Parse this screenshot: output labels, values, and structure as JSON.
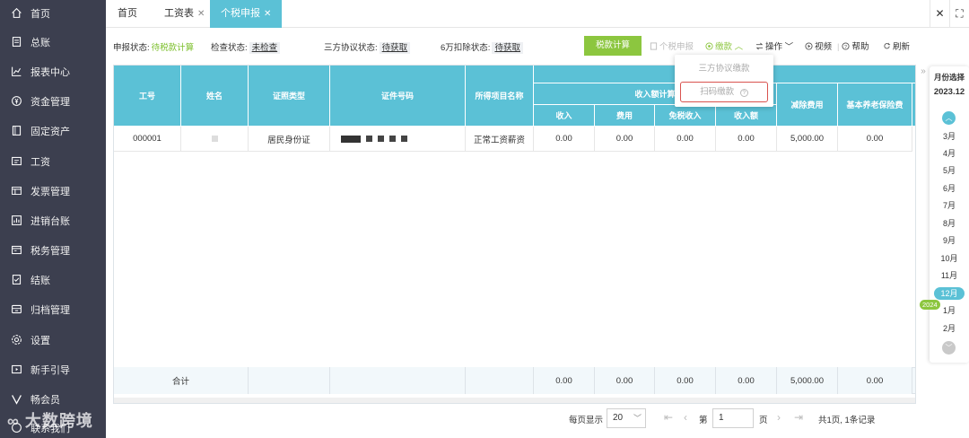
{
  "sidebar": {
    "items": [
      {
        "label": "首页",
        "icon": "home-icon"
      },
      {
        "label": "总账",
        "icon": "ledger-icon"
      },
      {
        "label": "报表中心",
        "icon": "chart-icon"
      },
      {
        "label": "资金管理",
        "icon": "money-icon"
      },
      {
        "label": "固定资产",
        "icon": "asset-icon"
      },
      {
        "label": "工资",
        "icon": "salary-icon"
      },
      {
        "label": "发票管理",
        "icon": "invoice-icon"
      },
      {
        "label": "进销台账",
        "icon": "inventory-icon"
      },
      {
        "label": "税务管理",
        "icon": "tax-icon"
      },
      {
        "label": "结账",
        "icon": "checkout-icon"
      },
      {
        "label": "归档管理",
        "icon": "archive-icon"
      },
      {
        "label": "设置",
        "icon": "settings-icon"
      },
      {
        "label": "新手引导",
        "icon": "guide-icon"
      },
      {
        "label": "畅会员",
        "icon": "vip-icon"
      },
      {
        "label": "联系我们",
        "icon": "contact-icon"
      }
    ]
  },
  "tabs": [
    {
      "label": "首页"
    },
    {
      "label": "工资表"
    },
    {
      "label": "个税申报"
    }
  ],
  "status": {
    "declare_label": "申报状态:",
    "declare_value": "待税款计算",
    "check_label": "检查状态:",
    "check_value": "未检查",
    "tripartite_label": "三方协议状态:",
    "tripartite_value": "待获取",
    "deduct_label": "6万扣除状态:",
    "deduct_value": "待获取"
  },
  "toolbar": {
    "calc_button": "税款计算",
    "personal_declare": "个税申报",
    "pay": "缴款",
    "operation": "操作",
    "video": "视频",
    "help": "帮助",
    "refresh": "刷新"
  },
  "pay_dropdown": {
    "items": [
      "三方协议缴款",
      "扫码缴款"
    ]
  },
  "table": {
    "headers": {
      "emp_no": "工号",
      "name": "姓名",
      "id_type": "证照类型",
      "id_no": "证件号码",
      "item_name": "所得项目名称",
      "income_group": "收入额计算",
      "income": "收入",
      "expense": "费用",
      "taxfree": "免税收入",
      "income_amt": "收入额",
      "deduct": "减除费用",
      "pension": "基本养老保险费"
    },
    "rows": [
      {
        "emp_no": "000001",
        "name": "",
        "id_type": "居民身份证",
        "id_no": "",
        "item_name": "正常工资薪资",
        "income": "0.00",
        "expense": "0.00",
        "taxfree": "0.00",
        "income_amt": "0.00",
        "deduct": "5,000.00",
        "pension": "0.00"
      }
    ],
    "footer": {
      "label": "合计",
      "income": "0.00",
      "expense": "0.00",
      "taxfree": "0.00",
      "income_amt": "0.00",
      "deduct": "5,000.00",
      "pension": "0.00"
    }
  },
  "pager": {
    "per_page_label": "每页显示",
    "per_page_value": "20",
    "page_prefix": "第",
    "page_value": "1",
    "page_suffix": "页",
    "summary": "共1页, 1条记录"
  },
  "month_panel": {
    "title": "月份选择",
    "current": "2023.12",
    "months": [
      "3月",
      "4月",
      "5月",
      "6月",
      "7月",
      "8月",
      "9月",
      "10月",
      "11月",
      "12月",
      "1月",
      "2月"
    ],
    "selected_index": 9,
    "year_badge": "2024"
  },
  "watermark": "大数跨境",
  "colors": {
    "sidebar": "#3c3f4f",
    "accent": "#5bc1d6",
    "green": "#8cc63f",
    "highlight": "#d9534f"
  }
}
